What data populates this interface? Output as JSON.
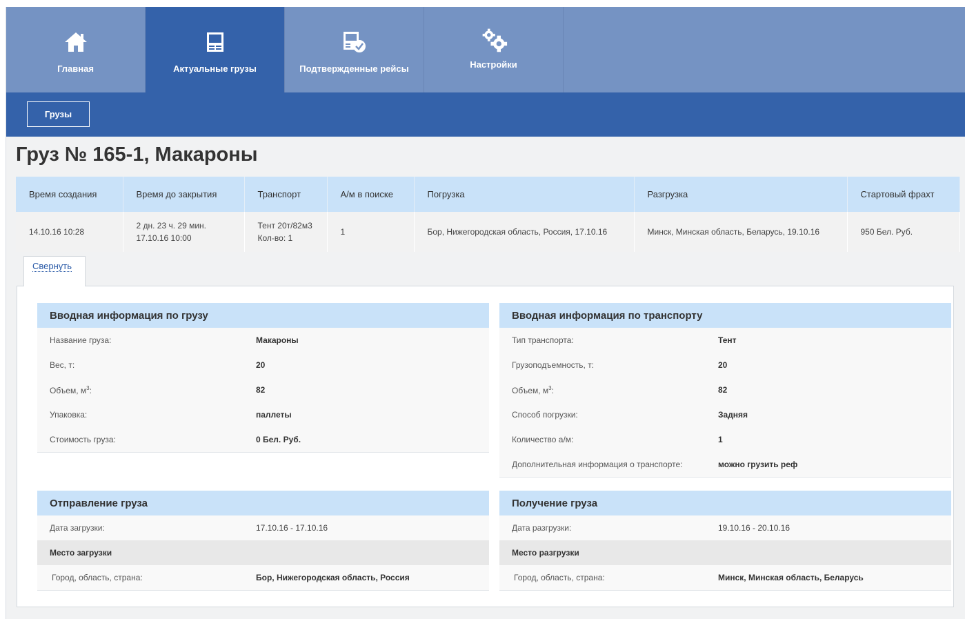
{
  "nav": {
    "tabs": [
      {
        "label": "Главная",
        "icon": "home-icon",
        "active": false
      },
      {
        "label": "Актуальные грузы",
        "icon": "document-icon",
        "active": true
      },
      {
        "label": "Подтвержденные рейсы",
        "icon": "confirmed-document-icon",
        "active": false
      },
      {
        "label": "Настройки",
        "icon": "gears-icon",
        "active": false
      }
    ],
    "sub_button": "Грузы"
  },
  "page": {
    "title": "Груз № 165-1, Макароны"
  },
  "summary": {
    "headers": [
      "Время создания",
      "Время до закрытия",
      "Транспорт",
      "А/м в поиске",
      "Погрузка",
      "Разгрузка",
      "Стартовый фрахт"
    ],
    "row": {
      "created": "14.10.16 10:28",
      "time_left": "2 дн. 23 ч. 29 мин.",
      "close_date": "17.10.16 10:00",
      "transport": "Тент 20т/82м3",
      "quantity": "Кол-во: 1",
      "trucks_searching": "1",
      "loading": "Бор, Нижегородская область, Россия, 17.10.16",
      "unloading": "Минск, Минская область, Беларусь, 19.10.16",
      "freight": "950 Бел. Руб."
    }
  },
  "collapse_label": "Свернуть",
  "cargo_info": {
    "title": "Вводная информация по грузу",
    "name_label": "Название груза:",
    "name_value": "Макароны",
    "weight_label": "Вес, т:",
    "weight_value": "20",
    "volume_label": "Объем, м",
    "volume_sup": "3",
    "volume_value": "82",
    "packing_label": "Упаковка:",
    "packing_value": "паллеты",
    "cost_label": "Стоимость груза:",
    "cost_value": "0 Бел. Руб."
  },
  "transport_info": {
    "title": "Вводная информация по транспорту",
    "type_label": "Тип транспорта:",
    "type_value": "Тент",
    "capacity_label": "Грузоподъемность, т:",
    "capacity_value": "20",
    "volume_label": "Объем, м",
    "volume_sup": "3",
    "volume_value": "82",
    "loading_method_label": "Способ погрузки:",
    "loading_method_value": "Задняя",
    "count_label": "Количество а/м:",
    "count_value": "1",
    "extra_label": "Дополнительная информация о транспорте:",
    "extra_value": "можно грузить реф"
  },
  "dispatch": {
    "title": "Отправление груза",
    "date_label": "Дата загрузки:",
    "date_value": "17.10.16 - 17.10.16",
    "place_header": "Место загрузки",
    "city_label": "Город, область, страна:",
    "city_value": "Бор, Нижегородская область, Россия"
  },
  "receipt": {
    "title": "Получение груза",
    "date_label": "Дата разгрузки:",
    "date_value": "19.10.16 - 20.10.16",
    "place_header": "Место разгрузки",
    "city_label": "Город, область, страна:",
    "city_value": "Минск, Минская область, Беларусь"
  }
}
